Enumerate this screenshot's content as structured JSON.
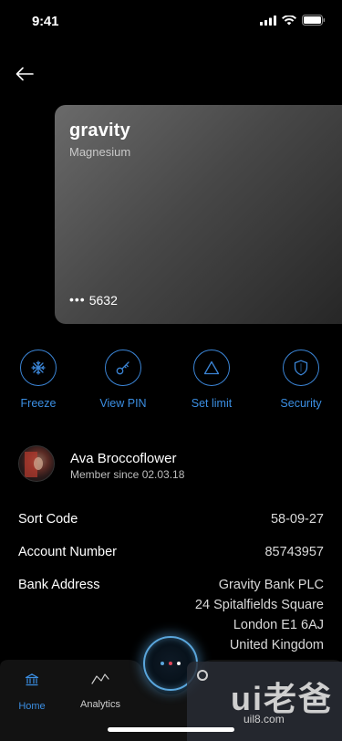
{
  "status_bar": {
    "time": "9:41"
  },
  "card": {
    "brand": "gravity",
    "tier": "Magnesium",
    "masked_dots": "•••",
    "last_digits": "5632"
  },
  "actions": [
    {
      "label": "Freeze",
      "icon": "snowflake-icon"
    },
    {
      "label": "View PIN",
      "icon": "key-icon"
    },
    {
      "label": "Set limit",
      "icon": "triangle-icon"
    },
    {
      "label": "Security",
      "icon": "shield-icon"
    }
  ],
  "profile": {
    "name": "Ava Broccoflower",
    "member_since": "Member since 02.03.18"
  },
  "details": {
    "sort_code": {
      "label": "Sort Code",
      "value": "58-09-27"
    },
    "account_number": {
      "label": "Account Number",
      "value": "85743957"
    },
    "bank_address": {
      "label": "Bank Address",
      "lines": [
        "Gravity Bank PLC",
        "24 Spitalfields Square",
        "London E1 6AJ",
        "United Kingdom"
      ]
    }
  },
  "tabs": [
    {
      "label": "Home",
      "icon": "bank-icon",
      "active": true
    },
    {
      "label": "Analytics",
      "icon": "chart-line-icon",
      "active": false
    }
  ],
  "fab": {
    "dots": [
      "#5aa6dc",
      "#e0475a",
      "#f2f2f2"
    ]
  },
  "colors": {
    "accent": "#3b8ee2",
    "background": "#000000",
    "tab_bar": "#121212"
  },
  "watermark": {
    "logo": "ui老爸",
    "url": "uil8.com"
  }
}
